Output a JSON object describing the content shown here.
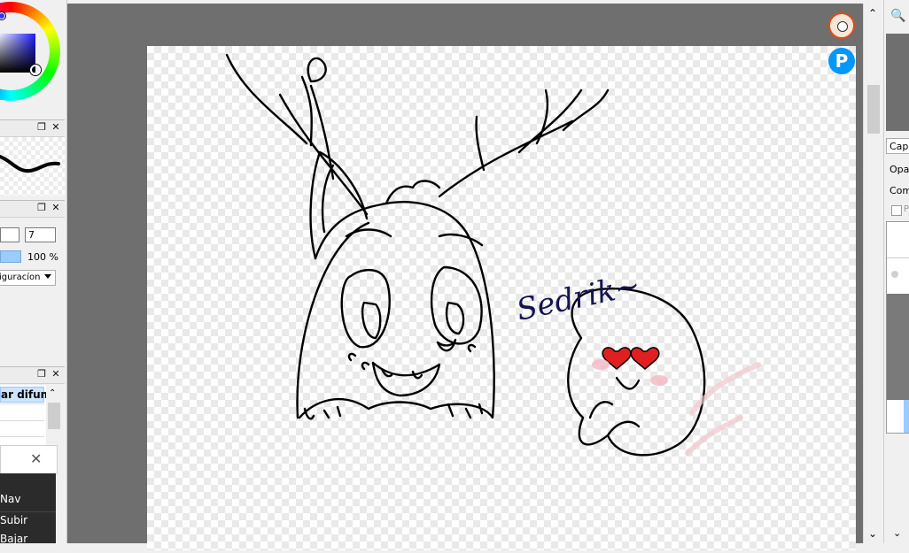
{
  "brush_panel": {
    "size_value": "7",
    "opacity_value": "100 %",
    "config_dropdown": "iguracíon"
  },
  "layer_list_panel": {
    "blend_header": "ar difum"
  },
  "popup": {
    "items": [
      "Nav",
      "Subir",
      "Bajar"
    ]
  },
  "right_panel": {
    "tab_label": "Capa",
    "opacity_label": "Opac",
    "blend_label": "Comb",
    "checkbox_label": "P"
  },
  "canvas": {
    "signature_text": "Sedrik~"
  },
  "colors": {
    "canvas_bg": "#6f6f6f",
    "selection_blue": "#99ccff",
    "pixiv_blue": "#0096fa"
  },
  "icons": [
    "zoom-icon",
    "user-avatar-icon",
    "pixiv-icon",
    "close-icon",
    "restore-icon",
    "scroll-up-icon",
    "scroll-down-icon"
  ]
}
